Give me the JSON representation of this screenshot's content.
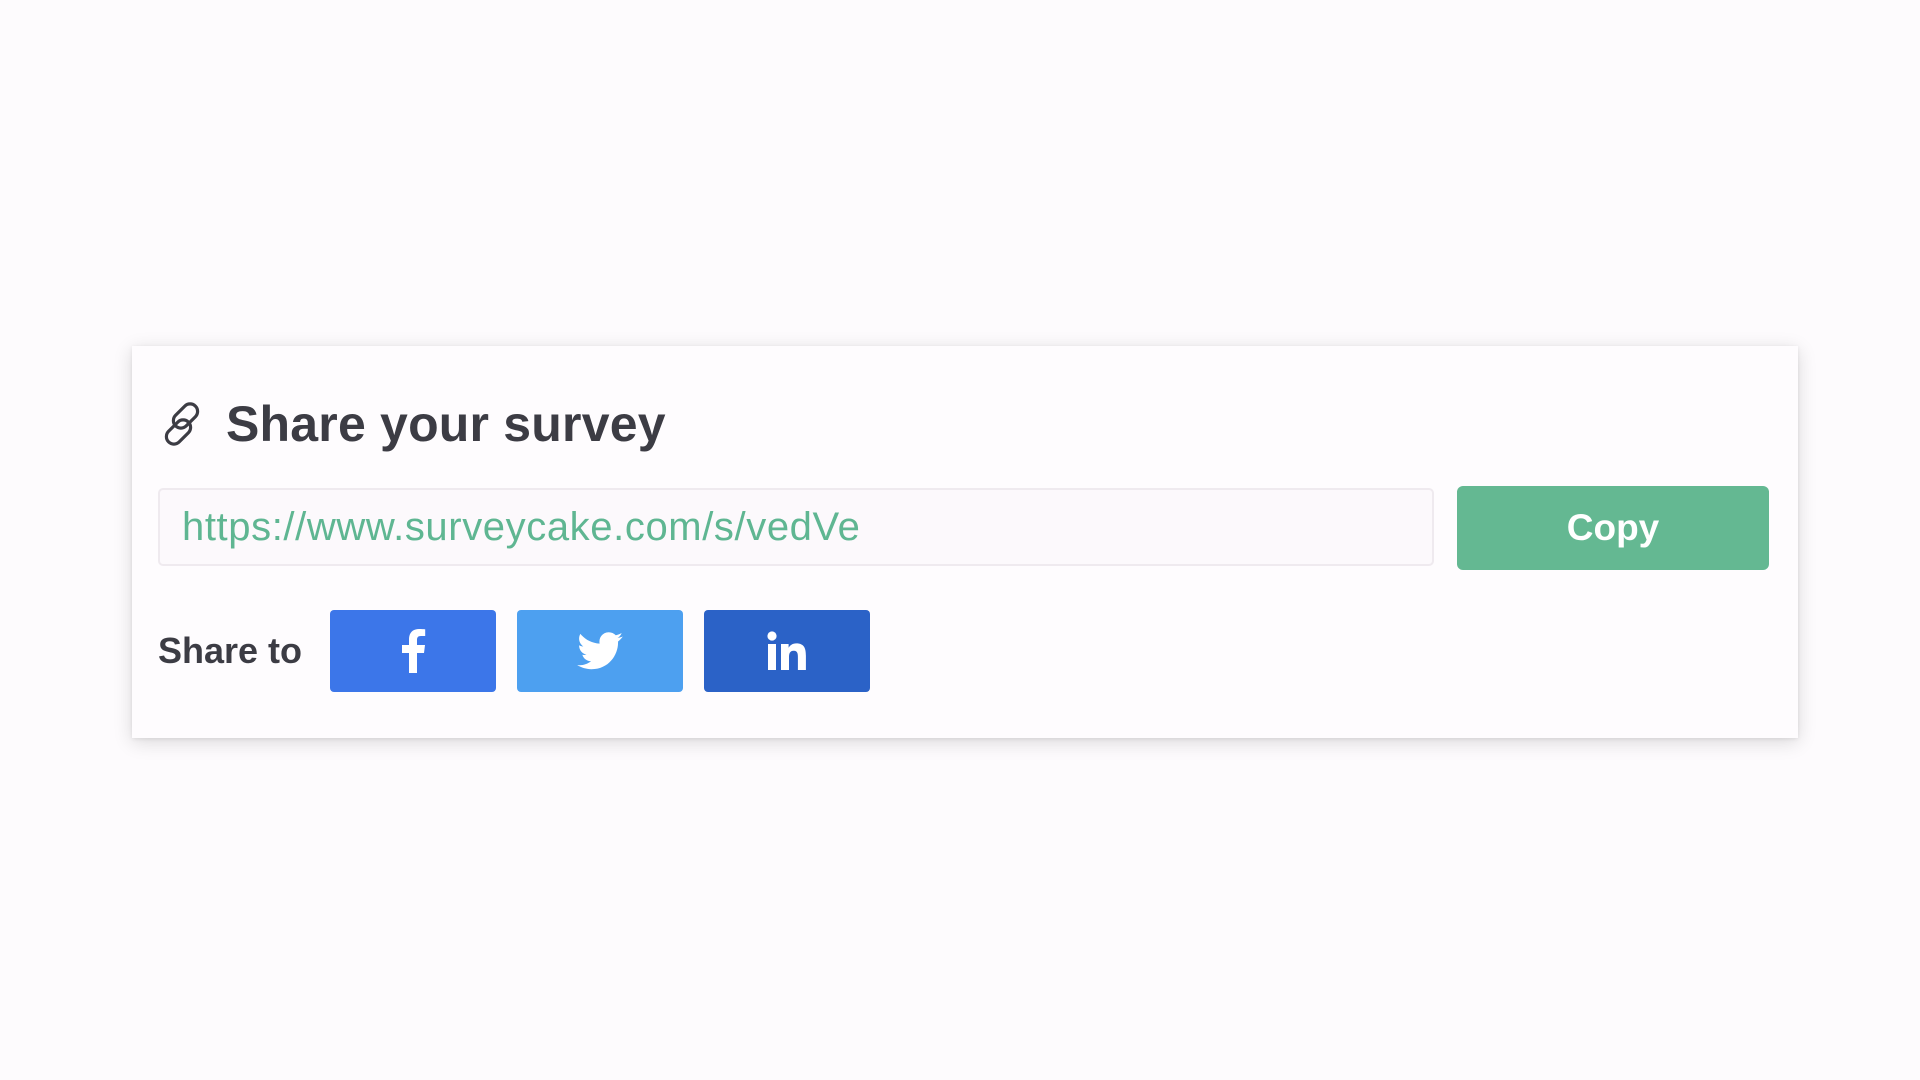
{
  "share_panel": {
    "title": "Share your survey",
    "url_value": "https://www.surveycake.com/s/vedVe",
    "copy_label": "Copy",
    "share_to_label": "Share to",
    "icons": {
      "title_icon": "link-icon",
      "facebook": "facebook-icon",
      "twitter": "twitter-icon",
      "linkedin": "linkedin-icon"
    }
  },
  "colors": {
    "url_text": "#5fb692",
    "copy_button": "#64b892",
    "facebook": "#3c76e9",
    "twitter": "#4da0f0",
    "linkedin": "#2b62c7",
    "title_text": "#3c3c44"
  }
}
